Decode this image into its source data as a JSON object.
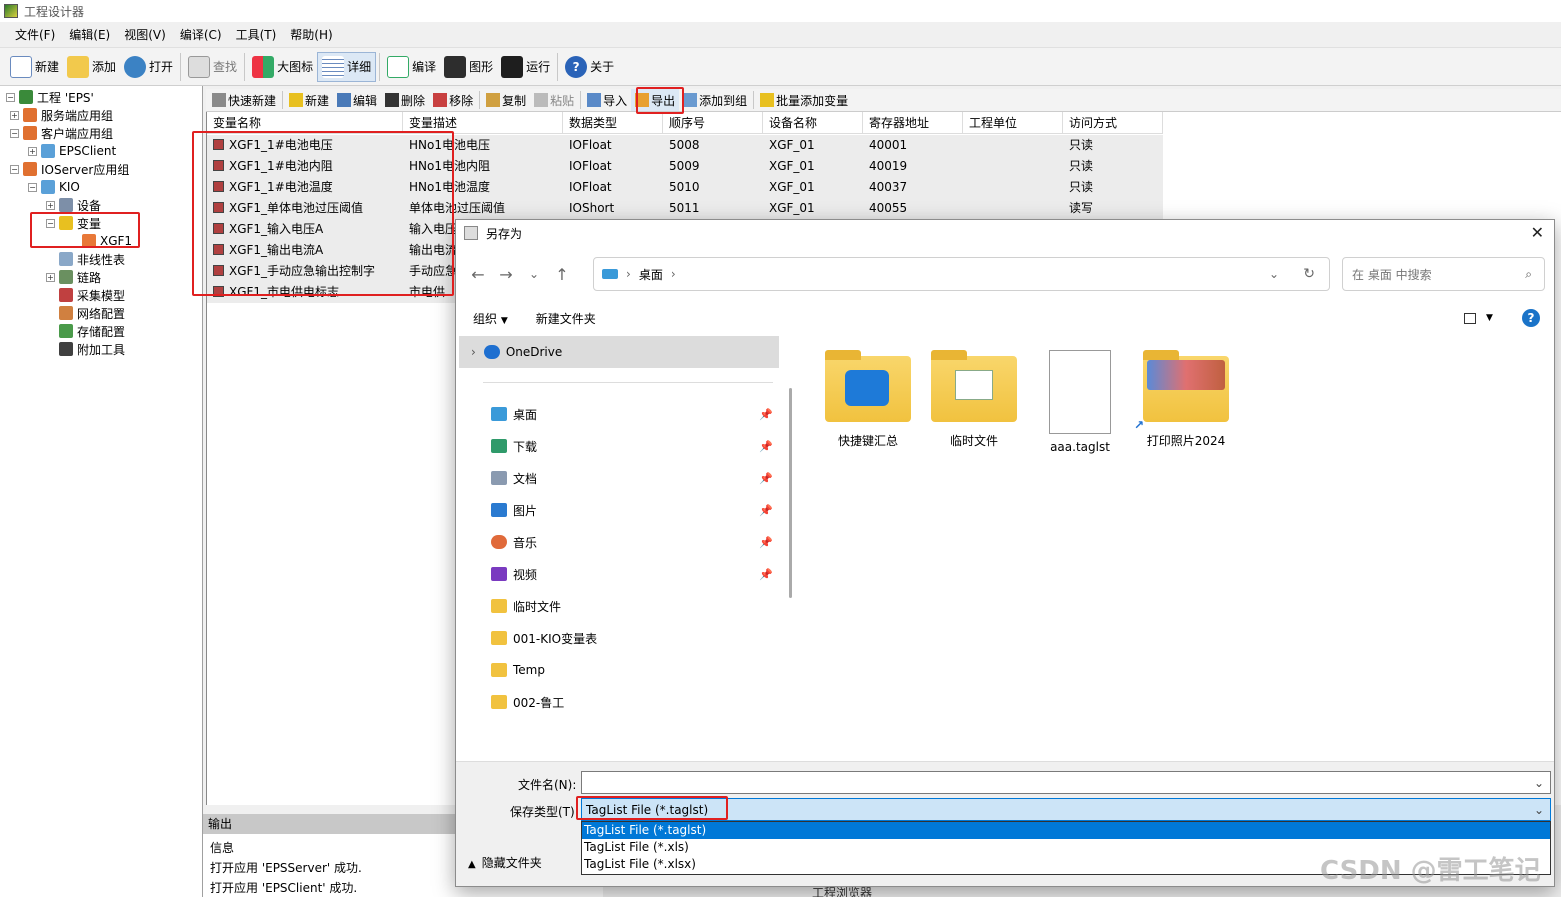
{
  "window": {
    "title": "工程设计器"
  },
  "menu": [
    "文件(F)",
    "编辑(E)",
    "视图(V)",
    "编译(C)",
    "工具(T)",
    "帮助(H)"
  ],
  "toolbar": {
    "new": "新建",
    "add": "添加",
    "open": "打开",
    "find": "查找",
    "large_icon": "大图标",
    "detail": "详细",
    "compile": "编译",
    "graphic": "图形",
    "run": "运行",
    "about": "关于"
  },
  "tree": {
    "project": "工程 'EPS'",
    "server_group": "服务端应用组",
    "client_group": "客户端应用组",
    "eps_client": "EPSClient",
    "ioserver_group": "IOServer应用组",
    "kio": "KIO",
    "device": "设备",
    "variable": "变量",
    "xgf1": "XGF1",
    "nonlinear": "非线性表",
    "link": "链路",
    "collect_model": "采集模型",
    "network": "网络配置",
    "storage": "存储配置",
    "addon": "附加工具"
  },
  "var_toolbar": {
    "quick_new": "快速新建",
    "new": "新建",
    "edit": "编辑",
    "delete": "删除",
    "remove": "移除",
    "copy": "复制",
    "paste": "粘贴",
    "import": "导入",
    "export": "导出",
    "add_to_group": "添加到组",
    "batch_add": "批量添加变量"
  },
  "grid": {
    "headers": [
      "变量名称",
      "变量描述",
      "数据类型",
      "顺序号",
      "设备名称",
      "寄存器地址",
      "工程单位",
      "访问方式"
    ],
    "rows": [
      [
        "XGF1_1#电池电压",
        "HNo1电池电压",
        "IOFloat",
        "5008",
        "XGF_01",
        "40001",
        "",
        "只读"
      ],
      [
        "XGF1_1#电池内阻",
        "HNo1电池内阻",
        "IOFloat",
        "5009",
        "XGF_01",
        "40019",
        "",
        "只读"
      ],
      [
        "XGF1_1#电池温度",
        "HNo1电池温度",
        "IOFloat",
        "5010",
        "XGF_01",
        "40037",
        "",
        "只读"
      ],
      [
        "XGF1_单体电池过压阈值",
        "单体电池过压阈值",
        "IOShort",
        "5011",
        "XGF_01",
        "40055",
        "",
        "读写"
      ],
      [
        "XGF1_输入电压A",
        "输入电压",
        "",
        "",
        "",
        "",
        "",
        ""
      ],
      [
        "XGF1_输出电流A",
        "输出电流",
        "",
        "",
        "",
        "",
        "",
        ""
      ],
      [
        "XGF1_手动应急输出控制字",
        "手动应急",
        "",
        "",
        "",
        "",
        "",
        ""
      ],
      [
        "XGF1_市电供电标志",
        "市电供",
        "",
        "",
        "",
        "",
        "",
        ""
      ]
    ]
  },
  "output": {
    "title": "输出",
    "info_label": "信息",
    "lines": [
      "打开应用 'EPSServer' 成功.",
      "打开应用 'EPSClient' 成功."
    ]
  },
  "bottom_caption": "工程浏览器",
  "dialog": {
    "title": "另存为",
    "close": "✕",
    "breadcrumb": "桌面",
    "search_placeholder": "在 桌面 中搜索",
    "organize": "组织",
    "new_folder": "新建文件夹",
    "nav": {
      "onedrive": "OneDrive",
      "quick": [
        "桌面",
        "下载",
        "文档",
        "图片",
        "音乐",
        "视频"
      ],
      "folders": [
        "临时文件",
        "001-KIO变量表",
        "Temp",
        "002-鲁工"
      ]
    },
    "files": [
      "快捷键汇总",
      "临时文件",
      "aaa.taglst",
      "打印照片2024"
    ],
    "filename_label": "文件名(N):",
    "filename_value": "",
    "filetype_label": "保存类型(T):",
    "filetype_value": "TagList File (*.taglst)",
    "filetype_options": [
      "TagList File (*.taglst)",
      "TagList File (*.xls)",
      "TagList File (*.xlsx)"
    ],
    "hide_folders": "隐藏文件夹"
  },
  "watermark": "CSDN @雷工笔记",
  "colors": {
    "highlight": "#e02020",
    "selection": "#0078d7",
    "folder": "#f1c23f"
  }
}
